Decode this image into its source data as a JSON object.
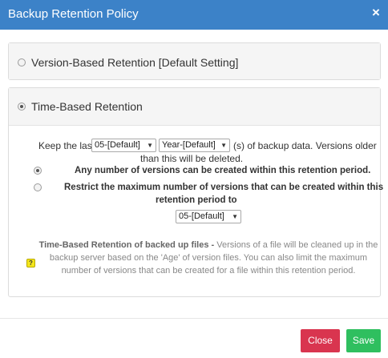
{
  "dialog": {
    "title": "Backup Retention Policy",
    "close_icon": "×"
  },
  "options": {
    "version_based": {
      "label": "Version-Based Retention [Default Setting]",
      "selected": false
    },
    "time_based": {
      "label": "Time-Based Retention",
      "selected": true
    }
  },
  "time_based": {
    "keep_prefix": "Keep the last",
    "count_value": "05-[Default]",
    "unit_value": "Year-[Default]",
    "keep_suffix_1": "(s) of backup data. Versions older",
    "keep_suffix_2": "than this will be deleted.",
    "sub_options": {
      "any": {
        "label": "Any number of versions can be created within this retention period.",
        "selected": true
      },
      "restrict": {
        "label_line1": "Restrict the maximum number of versions that can be created within this",
        "label_line2": "retention period to",
        "selected": false,
        "max_value": "05-[Default]"
      }
    },
    "note": {
      "lead": "Time-Based Retention of backed up files - ",
      "line1": "Versions of a file will be cleaned up in the",
      "line2": "backup server based on the 'Age' of version files. You can also limit the maximum",
      "line3": "number of versions that can be created for a file within this retention period."
    },
    "help_icon": "?"
  },
  "footer": {
    "close_label": "Close",
    "save_label": "Save"
  },
  "colors": {
    "header": "#3c82c8",
    "close_button": "#d9354f",
    "save_button": "#2fbf5f"
  }
}
